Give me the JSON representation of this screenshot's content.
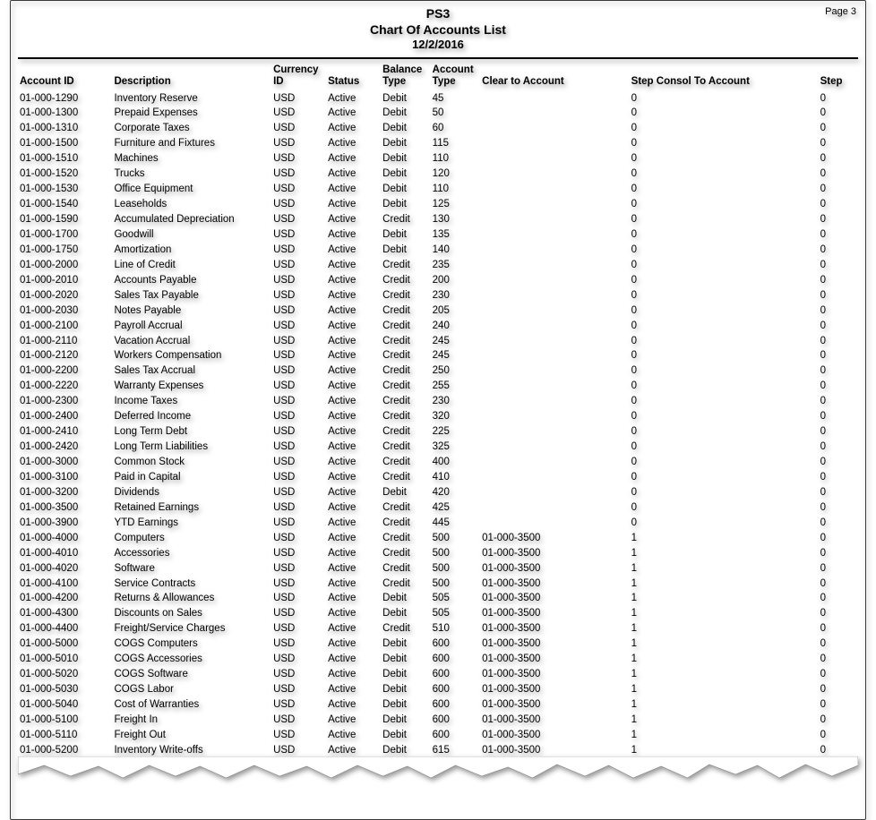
{
  "page_label": "Page 3",
  "header": {
    "org": "PS3",
    "title": "Chart Of Accounts List",
    "date": "12/2/2016"
  },
  "columns": {
    "id": "Account ID",
    "desc": "Description",
    "curr_l1": "Currency",
    "curr_l2": "ID",
    "status": "Status",
    "bal_l1": "Balance",
    "bal_l2": "Type",
    "atype_l1": "Account",
    "atype_l2": "Type",
    "clear": "Clear to Account",
    "sconsol": "Step Consol To Account",
    "step": "Step"
  },
  "rows": [
    {
      "id": "01-000-1290",
      "desc": "Inventory Reserve",
      "curr": "USD",
      "status": "Active",
      "bal": "Debit",
      "atype": "45",
      "clear": "",
      "sconsol": "0",
      "step": "0"
    },
    {
      "id": "01-000-1300",
      "desc": "Prepaid Expenses",
      "curr": "USD",
      "status": "Active",
      "bal": "Debit",
      "atype": "50",
      "clear": "",
      "sconsol": "0",
      "step": "0"
    },
    {
      "id": "01-000-1310",
      "desc": "Corporate Taxes",
      "curr": "USD",
      "status": "Active",
      "bal": "Debit",
      "atype": "60",
      "clear": "",
      "sconsol": "0",
      "step": "0"
    },
    {
      "id": "01-000-1500",
      "desc": "Furniture and Fixtures",
      "curr": "USD",
      "status": "Active",
      "bal": "Debit",
      "atype": "115",
      "clear": "",
      "sconsol": "0",
      "step": "0"
    },
    {
      "id": "01-000-1510",
      "desc": "Machines",
      "curr": "USD",
      "status": "Active",
      "bal": "Debit",
      "atype": "110",
      "clear": "",
      "sconsol": "0",
      "step": "0"
    },
    {
      "id": "01-000-1520",
      "desc": "Trucks",
      "curr": "USD",
      "status": "Active",
      "bal": "Debit",
      "atype": "120",
      "clear": "",
      "sconsol": "0",
      "step": "0"
    },
    {
      "id": "01-000-1530",
      "desc": "Office Equipment",
      "curr": "USD",
      "status": "Active",
      "bal": "Debit",
      "atype": "110",
      "clear": "",
      "sconsol": "0",
      "step": "0"
    },
    {
      "id": "01-000-1540",
      "desc": "Leaseholds",
      "curr": "USD",
      "status": "Active",
      "bal": "Debit",
      "atype": "125",
      "clear": "",
      "sconsol": "0",
      "step": "0"
    },
    {
      "id": "01-000-1590",
      "desc": "Accumulated Depreciation",
      "curr": "USD",
      "status": "Active",
      "bal": "Credit",
      "atype": "130",
      "clear": "",
      "sconsol": "0",
      "step": "0"
    },
    {
      "id": "01-000-1700",
      "desc": "Goodwill",
      "curr": "USD",
      "status": "Active",
      "bal": "Debit",
      "atype": "135",
      "clear": "",
      "sconsol": "0",
      "step": "0"
    },
    {
      "id": "01-000-1750",
      "desc": "Amortization",
      "curr": "USD",
      "status": "Active",
      "bal": "Debit",
      "atype": "140",
      "clear": "",
      "sconsol": "0",
      "step": "0"
    },
    {
      "id": "01-000-2000",
      "desc": "Line of Credit",
      "curr": "USD",
      "status": "Active",
      "bal": "Credit",
      "atype": "235",
      "clear": "",
      "sconsol": "0",
      "step": "0"
    },
    {
      "id": "01-000-2010",
      "desc": "Accounts Payable",
      "curr": "USD",
      "status": "Active",
      "bal": "Credit",
      "atype": "200",
      "clear": "",
      "sconsol": "0",
      "step": "0"
    },
    {
      "id": "01-000-2020",
      "desc": "Sales Tax Payable",
      "curr": "USD",
      "status": "Active",
      "bal": "Credit",
      "atype": "230",
      "clear": "",
      "sconsol": "0",
      "step": "0"
    },
    {
      "id": "01-000-2030",
      "desc": "Notes Payable",
      "curr": "USD",
      "status": "Active",
      "bal": "Credit",
      "atype": "205",
      "clear": "",
      "sconsol": "0",
      "step": "0"
    },
    {
      "id": "01-000-2100",
      "desc": "Payroll Accrual",
      "curr": "USD",
      "status": "Active",
      "bal": "Credit",
      "atype": "240",
      "clear": "",
      "sconsol": "0",
      "step": "0"
    },
    {
      "id": "01-000-2110",
      "desc": "Vacation Accrual",
      "curr": "USD",
      "status": "Active",
      "bal": "Credit",
      "atype": "245",
      "clear": "",
      "sconsol": "0",
      "step": "0"
    },
    {
      "id": "01-000-2120",
      "desc": "Workers Compensation",
      "curr": "USD",
      "status": "Active",
      "bal": "Credit",
      "atype": "245",
      "clear": "",
      "sconsol": "0",
      "step": "0"
    },
    {
      "id": "01-000-2200",
      "desc": "Sales Tax Accrual",
      "curr": "USD",
      "status": "Active",
      "bal": "Credit",
      "atype": "250",
      "clear": "",
      "sconsol": "0",
      "step": "0"
    },
    {
      "id": "01-000-2220",
      "desc": "Warranty Expenses",
      "curr": "USD",
      "status": "Active",
      "bal": "Credit",
      "atype": "255",
      "clear": "",
      "sconsol": "0",
      "step": "0"
    },
    {
      "id": "01-000-2300",
      "desc": "Income Taxes",
      "curr": "USD",
      "status": "Active",
      "bal": "Credit",
      "atype": "230",
      "clear": "",
      "sconsol": "0",
      "step": "0"
    },
    {
      "id": "01-000-2400",
      "desc": "Deferred Income",
      "curr": "USD",
      "status": "Active",
      "bal": "Credit",
      "atype": "320",
      "clear": "",
      "sconsol": "0",
      "step": "0"
    },
    {
      "id": "01-000-2410",
      "desc": "Long Term Debt",
      "curr": "USD",
      "status": "Active",
      "bal": "Credit",
      "atype": "225",
      "clear": "",
      "sconsol": "0",
      "step": "0"
    },
    {
      "id": "01-000-2420",
      "desc": "Long Term Liabilities",
      "curr": "USD",
      "status": "Active",
      "bal": "Credit",
      "atype": "325",
      "clear": "",
      "sconsol": "0",
      "step": "0"
    },
    {
      "id": "01-000-3000",
      "desc": "Common Stock",
      "curr": "USD",
      "status": "Active",
      "bal": "Credit",
      "atype": "400",
      "clear": "",
      "sconsol": "0",
      "step": "0"
    },
    {
      "id": "01-000-3100",
      "desc": "Paid in Capital",
      "curr": "USD",
      "status": "Active",
      "bal": "Credit",
      "atype": "410",
      "clear": "",
      "sconsol": "0",
      "step": "0"
    },
    {
      "id": "01-000-3200",
      "desc": "Dividends",
      "curr": "USD",
      "status": "Active",
      "bal": "Debit",
      "atype": "420",
      "clear": "",
      "sconsol": "0",
      "step": "0"
    },
    {
      "id": "01-000-3500",
      "desc": "Retained Earnings",
      "curr": "USD",
      "status": "Active",
      "bal": "Credit",
      "atype": "425",
      "clear": "",
      "sconsol": "0",
      "step": "0"
    },
    {
      "id": "01-000-3900",
      "desc": "YTD Earnings",
      "curr": "USD",
      "status": "Active",
      "bal": "Credit",
      "atype": "445",
      "clear": "",
      "sconsol": "0",
      "step": "0"
    },
    {
      "id": "01-000-4000",
      "desc": "Computers",
      "curr": "USD",
      "status": "Active",
      "bal": "Credit",
      "atype": "500",
      "clear": "01-000-3500",
      "sconsol": "1",
      "step": "0"
    },
    {
      "id": "01-000-4010",
      "desc": "Accessories",
      "curr": "USD",
      "status": "Active",
      "bal": "Credit",
      "atype": "500",
      "clear": "01-000-3500",
      "sconsol": "1",
      "step": "0"
    },
    {
      "id": "01-000-4020",
      "desc": "Software",
      "curr": "USD",
      "status": "Active",
      "bal": "Credit",
      "atype": "500",
      "clear": "01-000-3500",
      "sconsol": "1",
      "step": "0"
    },
    {
      "id": "01-000-4100",
      "desc": "Service Contracts",
      "curr": "USD",
      "status": "Active",
      "bal": "Credit",
      "atype": "500",
      "clear": "01-000-3500",
      "sconsol": "1",
      "step": "0"
    },
    {
      "id": "01-000-4200",
      "desc": "Returns & Allowances",
      "curr": "USD",
      "status": "Active",
      "bal": "Debit",
      "atype": "505",
      "clear": "01-000-3500",
      "sconsol": "1",
      "step": "0"
    },
    {
      "id": "01-000-4300",
      "desc": "Discounts on Sales",
      "curr": "USD",
      "status": "Active",
      "bal": "Debit",
      "atype": "505",
      "clear": "01-000-3500",
      "sconsol": "1",
      "step": "0"
    },
    {
      "id": "01-000-4400",
      "desc": "Freight/Service Charges",
      "curr": "USD",
      "status": "Active",
      "bal": "Credit",
      "atype": "510",
      "clear": "01-000-3500",
      "sconsol": "1",
      "step": "0"
    },
    {
      "id": "01-000-5000",
      "desc": "COGS Computers",
      "curr": "USD",
      "status": "Active",
      "bal": "Debit",
      "atype": "600",
      "clear": "01-000-3500",
      "sconsol": "1",
      "step": "0"
    },
    {
      "id": "01-000-5010",
      "desc": "COGS Accessories",
      "curr": "USD",
      "status": "Active",
      "bal": "Debit",
      "atype": "600",
      "clear": "01-000-3500",
      "sconsol": "1",
      "step": "0"
    },
    {
      "id": "01-000-5020",
      "desc": "COGS Software",
      "curr": "USD",
      "status": "Active",
      "bal": "Debit",
      "atype": "600",
      "clear": "01-000-3500",
      "sconsol": "1",
      "step": "0"
    },
    {
      "id": "01-000-5030",
      "desc": "COGS Labor",
      "curr": "USD",
      "status": "Active",
      "bal": "Debit",
      "atype": "600",
      "clear": "01-000-3500",
      "sconsol": "1",
      "step": "0"
    },
    {
      "id": "01-000-5040",
      "desc": "Cost of Warranties",
      "curr": "USD",
      "status": "Active",
      "bal": "Debit",
      "atype": "600",
      "clear": "01-000-3500",
      "sconsol": "1",
      "step": "0"
    },
    {
      "id": "01-000-5100",
      "desc": "Freight In",
      "curr": "USD",
      "status": "Active",
      "bal": "Debit",
      "atype": "600",
      "clear": "01-000-3500",
      "sconsol": "1",
      "step": "0"
    },
    {
      "id": "01-000-5110",
      "desc": "Freight Out",
      "curr": "USD",
      "status": "Active",
      "bal": "Debit",
      "atype": "600",
      "clear": "01-000-3500",
      "sconsol": "1",
      "step": "0"
    },
    {
      "id": "01-000-5200",
      "desc": "Inventory Write-offs",
      "curr": "USD",
      "status": "Active",
      "bal": "Debit",
      "atype": "615",
      "clear": "01-000-3500",
      "sconsol": "1",
      "step": "0"
    }
  ]
}
